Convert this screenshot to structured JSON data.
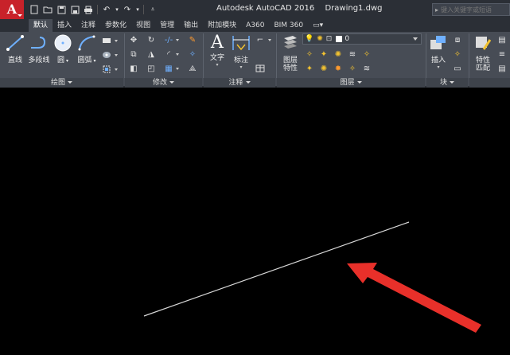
{
  "app": {
    "logo": "A",
    "title": "Autodesk AutoCAD 2016",
    "document": "Drawing1.dwg",
    "search_placeholder": "键入关键字或短语"
  },
  "quick_access": [
    {
      "icon": "new-file-icon",
      "glyph": "▭"
    },
    {
      "icon": "open-folder-icon",
      "glyph": "▣"
    },
    {
      "icon": "save-icon",
      "glyph": "▤"
    },
    {
      "icon": "save-as-icon",
      "glyph": "▥"
    },
    {
      "icon": "print-icon",
      "glyph": "⎙"
    },
    {
      "icon": "undo-icon",
      "glyph": "↶"
    },
    {
      "icon": "redo-icon",
      "glyph": "↷"
    },
    {
      "icon": "customize-icon",
      "glyph": "⌄"
    }
  ],
  "tabs": [
    {
      "label": "默认",
      "active": true
    },
    {
      "label": "插入"
    },
    {
      "label": "注释"
    },
    {
      "label": "参数化"
    },
    {
      "label": "视图"
    },
    {
      "label": "管理"
    },
    {
      "label": "输出"
    },
    {
      "label": "附加模块"
    },
    {
      "label": "A360"
    },
    {
      "label": "BIM 360"
    },
    {
      "label": "▭▾"
    }
  ],
  "ribbon": {
    "draw": {
      "title": "绘图",
      "line": "直线",
      "polyline": "多段线",
      "circle": "圆",
      "arc": "圆弧"
    },
    "modify": {
      "title": "修改"
    },
    "annotation": {
      "title": "注释",
      "text": "文字",
      "dimension": "标注"
    },
    "layers": {
      "title": "图层",
      "properties_line1": "图层",
      "properties_line2": "特性",
      "current_layer": "0"
    },
    "block": {
      "title": "块",
      "insert": "插入"
    },
    "properties": {
      "match_line1": "特性",
      "match_line2": "匹配"
    }
  },
  "colors": {
    "accent_red": "#c8222a",
    "ribbon_bg": "#474c55",
    "titlebar_bg": "#2b2f36",
    "canvas_bg": "#000000",
    "arrow_red": "#e8302a"
  }
}
